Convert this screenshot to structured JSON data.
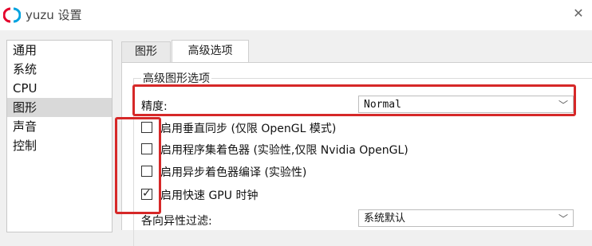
{
  "window": {
    "title": "yuzu 设置",
    "brand_colors": {
      "red": "#e4002b",
      "blue": "#00a3e0"
    },
    "close_icon": "close-icon"
  },
  "sidebar": {
    "items": [
      {
        "label": "通用",
        "selected": false
      },
      {
        "label": "系统",
        "selected": false
      },
      {
        "label": "CPU",
        "selected": false
      },
      {
        "label": "图形",
        "selected": true
      },
      {
        "label": "声音",
        "selected": false
      },
      {
        "label": "控制",
        "selected": false
      }
    ]
  },
  "tabs": [
    {
      "label": "图形",
      "active": false
    },
    {
      "label": "高级选项",
      "active": true
    }
  ],
  "advanced": {
    "group_title": "高级图形选项",
    "accuracy_label": "精度:",
    "accuracy_value": "Normal",
    "checkboxes": [
      {
        "label": "启用垂直同步 (仅限 OpenGL 模式)",
        "checked": false
      },
      {
        "label": "启用程序集着色器 (实验性,仅限 Nvidia OpenGL)",
        "checked": false
      },
      {
        "label": "启用异步着色器编译 (实验性)",
        "checked": false
      },
      {
        "label": "启用快速 GPU 时钟",
        "checked": true
      }
    ],
    "anisotropic_label": "各向异性过滤:",
    "anisotropic_value": "系统默认"
  },
  "annotation_color": "#d62828"
}
